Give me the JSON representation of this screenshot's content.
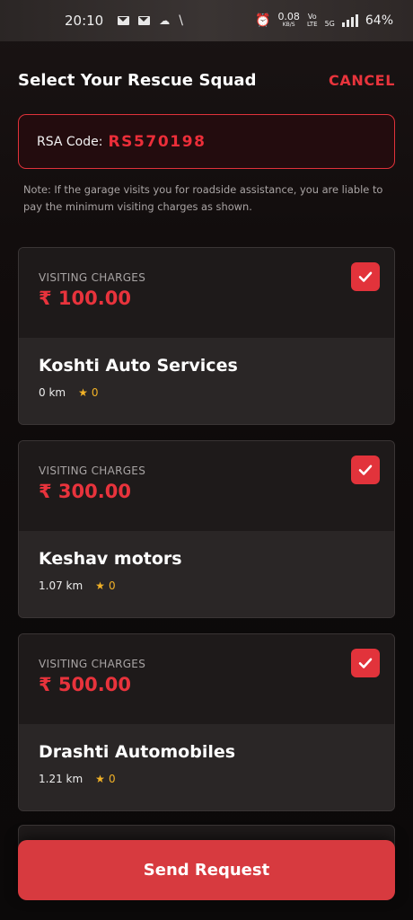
{
  "status_bar": {
    "time": "20:10",
    "net_speed_value": "0.08",
    "net_speed_unit": "KB/S",
    "volte_top": "Vo",
    "volte_bottom": "LTE",
    "network": "5G",
    "battery": "64%"
  },
  "header": {
    "title": "Select Your Rescue Squad",
    "cancel_label": "CANCEL"
  },
  "rsa": {
    "label": "RSA Code:",
    "code": "RS570198"
  },
  "note": "Note: If the garage visits you for roadside assistance, you are liable to pay the minimum visiting charges as shown.",
  "garages": [
    {
      "charges_label": "VISITING CHARGES",
      "charges": "₹ 100.00",
      "name": "Koshti Auto Services",
      "distance": "0 km",
      "rating": "0",
      "selected": true
    },
    {
      "charges_label": "VISITING CHARGES",
      "charges": "₹ 300.00",
      "name": "Keshav motors",
      "distance": "1.07 km",
      "rating": "0",
      "selected": true
    },
    {
      "charges_label": "VISITING CHARGES",
      "charges": "₹ 500.00",
      "name": "Drashti Automobiles",
      "distance": "1.21 km",
      "rating": "0",
      "selected": true
    }
  ],
  "send_button_label": "Send Request",
  "colors": {
    "accent": "#e2333b",
    "star": "#f2b227"
  }
}
